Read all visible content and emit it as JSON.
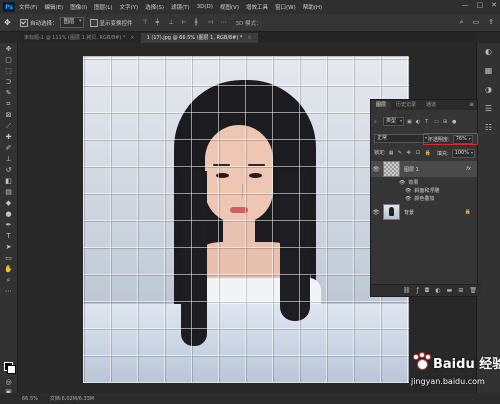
{
  "menubar": {
    "logo": "Ps",
    "items": [
      "文件(F)",
      "编辑(E)",
      "图像(I)",
      "图层(L)",
      "文字(Y)",
      "选择(S)",
      "滤镜(T)",
      "3D(D)",
      "视图(V)",
      "增效工具",
      "窗口(W)",
      "帮助(H)"
    ],
    "window_controls": [
      "—",
      "□",
      "✕"
    ]
  },
  "options": {
    "auto_select_label": "自动选择：",
    "auto_select_value": "图层",
    "transform_label": "显示变换控件",
    "mode_3d_label": "3D 模式："
  },
  "tabs": [
    {
      "label": "未标题-1 @ 111% (图层 1 拷贝, RGB/8#) *",
      "active": false
    },
    {
      "label": "1 (17).jpg @ 66.5% (图层 1, RGB/8#) *",
      "active": true
    }
  ],
  "layers_panel": {
    "tabs": [
      "图层",
      "历史记录",
      "通道"
    ],
    "filter_kind": "类型",
    "blend_mode": "正常",
    "opacity_label": "不透明度:",
    "opacity_value": "76%",
    "lock_label": "锁定:",
    "fill_label": "填充:",
    "fill_value": "100%",
    "layers": [
      {
        "name": "图层 1",
        "selected": true,
        "has_fx": true
      },
      {
        "name": "背景",
        "selected": false,
        "locked": true
      }
    ],
    "effects_label": "效果",
    "effects": [
      "斜面和浮雕",
      "颜色叠加"
    ],
    "fx_symbol": "fx"
  },
  "status": {
    "zoom": "66.5%",
    "doc_info": "文档:6.02M/6.33M"
  },
  "watermark": {
    "brand": "Baidu 经验",
    "url": "jingyan.baidu.com"
  }
}
